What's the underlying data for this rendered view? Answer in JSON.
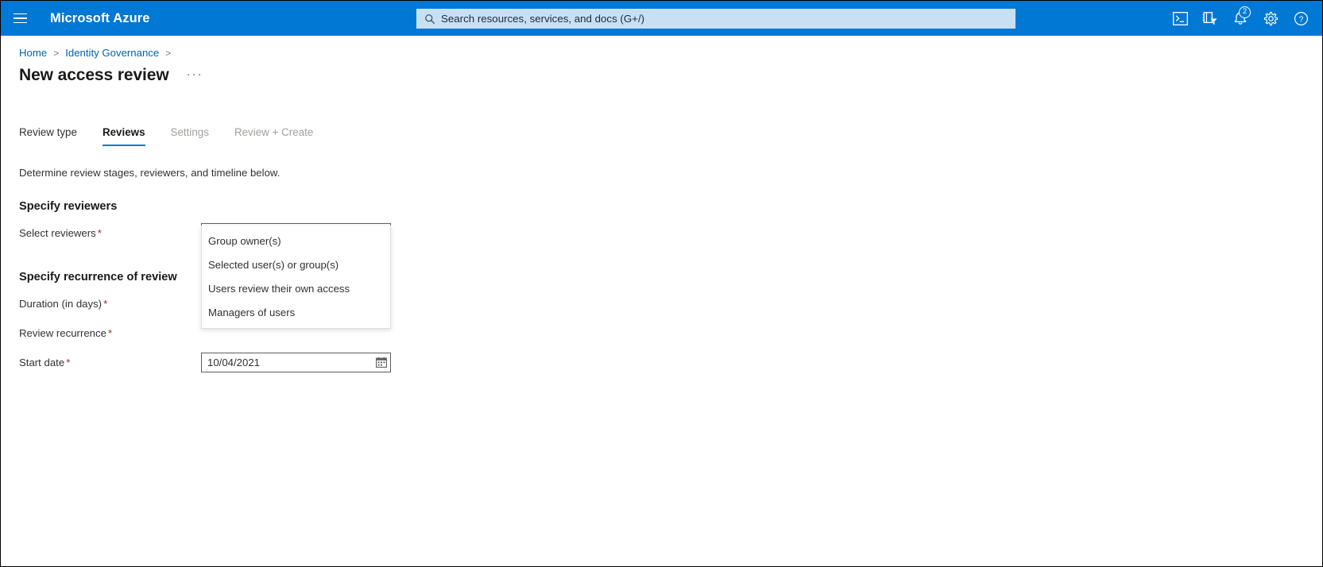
{
  "topbar": {
    "menu_icon": "hamburger-icon",
    "brand": "Microsoft Azure",
    "search": {
      "icon": "search-icon",
      "placeholder": "Search resources, services, and docs (G+/)",
      "value": ""
    },
    "actions": [
      {
        "name": "cloud-shell-icon",
        "label": "Cloud Shell"
      },
      {
        "name": "directories-filter-icon",
        "label": "Directories + subscriptions"
      },
      {
        "name": "notifications-bell-icon",
        "label": "Notifications",
        "badge": "2"
      },
      {
        "name": "settings-gear-icon",
        "label": "Settings"
      },
      {
        "name": "help-question-icon",
        "label": "Help"
      }
    ]
  },
  "breadcrumb": {
    "items": [
      "Home",
      "Identity Governance"
    ],
    "separator": ">"
  },
  "header": {
    "title": "New access review",
    "more_label": "···"
  },
  "tabs": [
    {
      "label": "Review type",
      "state": "enabled"
    },
    {
      "label": "Reviews",
      "state": "active"
    },
    {
      "label": "Settings",
      "state": "disabled"
    },
    {
      "label": "Review + Create",
      "state": "disabled"
    }
  ],
  "main": {
    "description": "Determine review stages, reviewers, and timeline below.",
    "sections": [
      {
        "heading": "Specify reviewers",
        "fields": [
          {
            "label": "Select reviewers",
            "required": "*",
            "type": "select",
            "value": ""
          }
        ]
      },
      {
        "heading": "Specify recurrence of review",
        "fields": [
          {
            "label": "Duration (in days)",
            "required": "*",
            "type": "select",
            "value": ""
          },
          {
            "label": "Review recurrence",
            "required": "*",
            "type": "select",
            "value": ""
          },
          {
            "label": "Start date",
            "required": "*",
            "type": "date",
            "value": "10/04/2021",
            "icon": "calendar-icon"
          }
        ]
      }
    ]
  },
  "dropdown": {
    "open": true,
    "options": [
      "Group owner(s)",
      "Selected user(s) or group(s)",
      "Users review their own access",
      "Managers of users"
    ]
  },
  "colors": {
    "azure_blue": "#0078d4",
    "search_bg": "#c7e0f4",
    "link": "#0063b1",
    "required_red": "#a4262c",
    "text": "#323130"
  }
}
